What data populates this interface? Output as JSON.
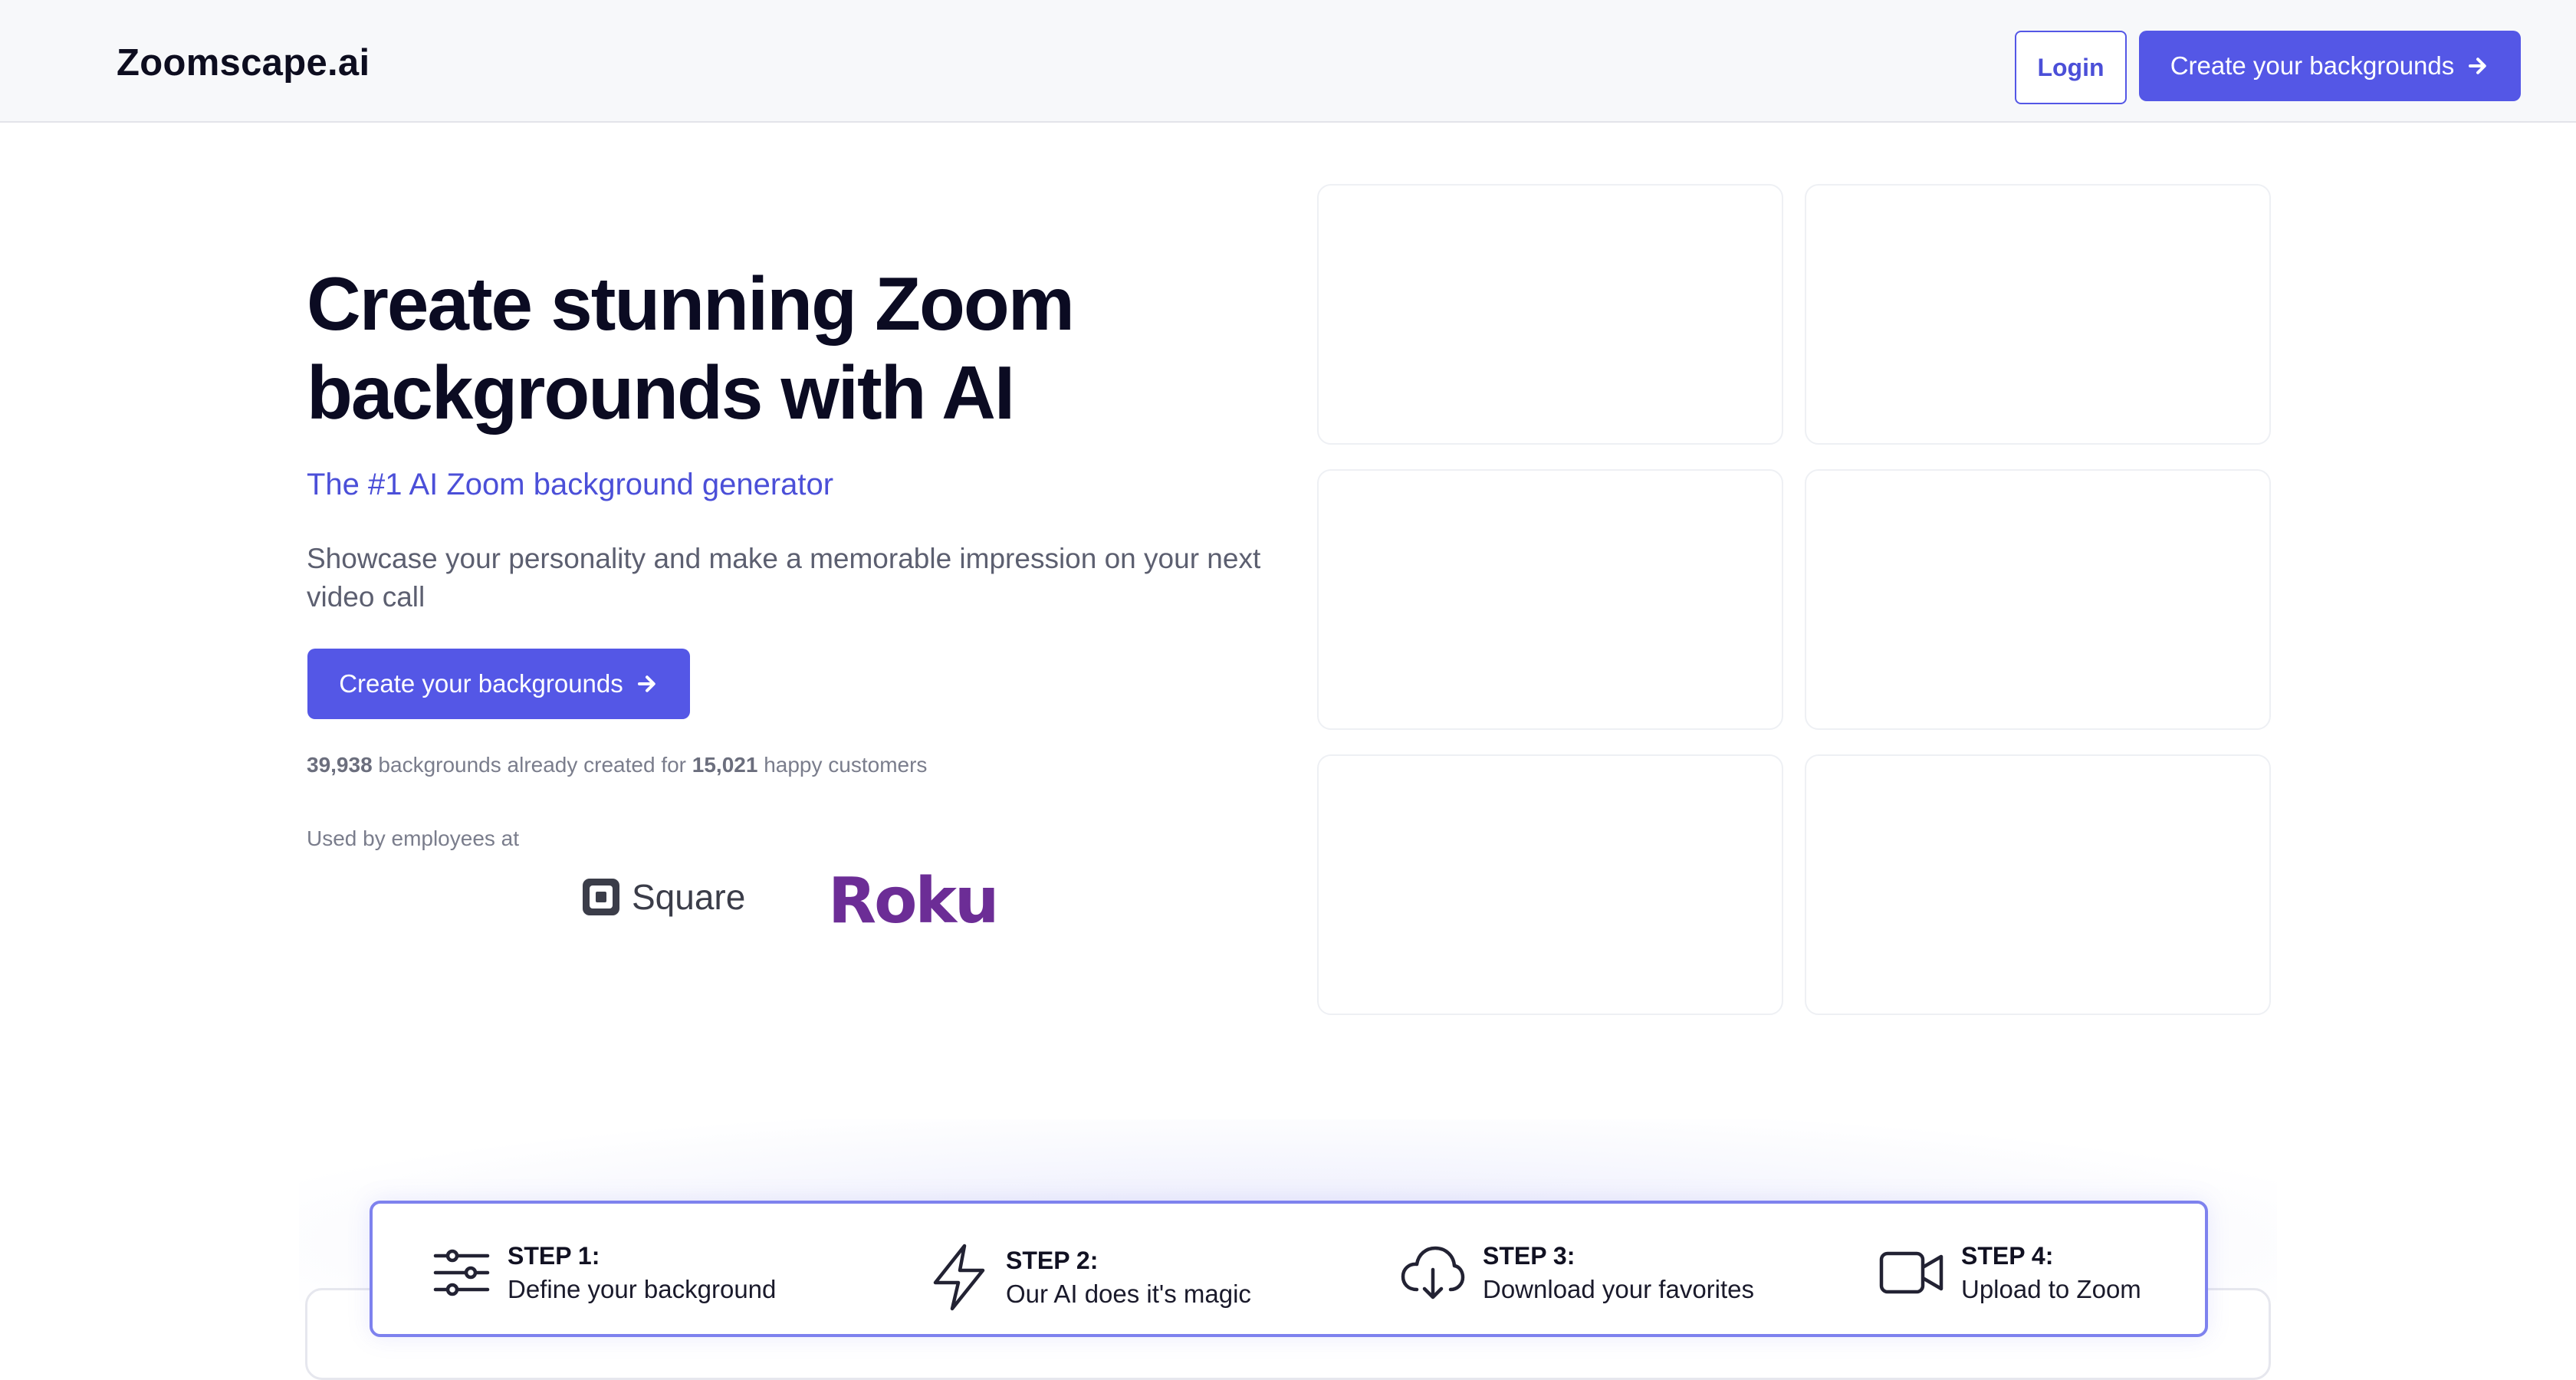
{
  "header": {
    "brand": "Zoomscape.ai",
    "login_label": "Login",
    "cta_label": "Create your backgrounds"
  },
  "hero": {
    "title_line1": "Create stunning Zoom",
    "title_line2": "backgrounds with AI",
    "subtitle": "The #1 AI Zoom background generator",
    "description": "Showcase your personality and make a memorable impression on your next video call",
    "cta_label": "Create your backgrounds",
    "stats": {
      "backgrounds_count": "39,938",
      "middle_text": "backgrounds already created for",
      "customers_count": "15,021",
      "end_text": "happy customers"
    },
    "used_by_label": "Used by employees at",
    "logos": {
      "square": "Square",
      "roku": "Roku"
    }
  },
  "steps": [
    {
      "label": "STEP 1:",
      "description": "Define your background",
      "icon": "sliders-icon"
    },
    {
      "label": "STEP 2:",
      "description": "Our AI does it's magic",
      "icon": "lightning-icon"
    },
    {
      "label": "STEP 3:",
      "description": "Download your favorites",
      "icon": "cloud-download-icon"
    },
    {
      "label": "STEP 4:",
      "description": "Upload to Zoom",
      "icon": "video-camera-icon"
    }
  ],
  "colors": {
    "accent": "#5457e6",
    "accent_text": "#4b4fd8",
    "roku_purple": "#6c2d96"
  }
}
